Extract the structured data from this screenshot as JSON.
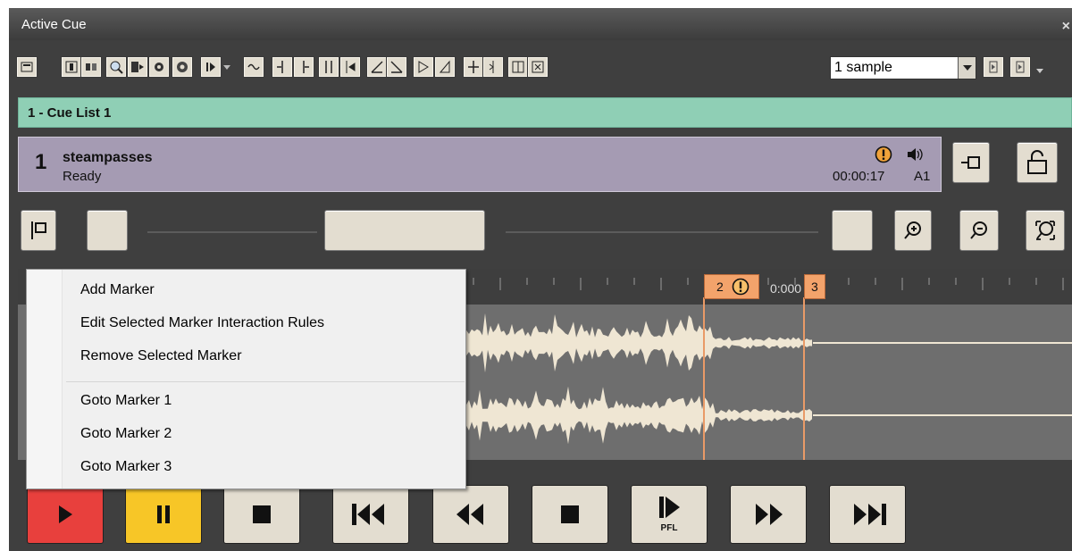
{
  "window": {
    "title": "Active Cue",
    "close_glyph": "×"
  },
  "toolbar": {
    "icons": [
      "properties-icon",
      "output-icon",
      "audio-output-icon",
      "zoom-icon",
      "audio-routing-icon",
      "settings-icon",
      "advanced-settings-icon",
      "play-options-icon",
      "loop-icon",
      "marker-left-icon",
      "marker-right-icon",
      "marker-start-icon",
      "marker-end-icon",
      "fade-in-icon",
      "fade-out-icon",
      "gain-in-icon",
      "gain-out-icon",
      "split-icon",
      "join-icon",
      "snap-left-icon",
      "snap-right-icon"
    ],
    "resolution_value": "1 sample",
    "nav_prev_icon": "nudge-left-icon",
    "nav_next_icon": "nudge-right-icon"
  },
  "cue_list": {
    "label": "1 - Cue List 1",
    "color": "#8fcfb5"
  },
  "cue": {
    "number": "1",
    "name": "steampasses",
    "status": "Ready",
    "duration": "00:00:17",
    "output": "A1",
    "panel_color": "#a59bb3"
  },
  "waveform": {
    "ruler_text": "0:000",
    "markers": [
      {
        "number": "2",
        "has_warning": true
      },
      {
        "number": "3",
        "has_warning": false
      }
    ],
    "marker_color": "#f3a36b"
  },
  "context_menu": {
    "items": [
      "Add Marker",
      "Edit Selected Marker Interaction Rules",
      "Remove Selected Marker",
      "Goto Marker 1",
      "Goto Marker 2",
      "Goto Marker 3"
    ]
  },
  "transport": {
    "play_color": "#e8403d",
    "pause_color": "#f7c627",
    "buttons": [
      "play-icon",
      "pause-icon",
      "stop-icon",
      "skip-to-start-icon",
      "rewind-icon",
      "stop-icon",
      "pfl-play-icon",
      "fast-forward-icon",
      "skip-to-end-icon"
    ],
    "pfl_label": "PFL"
  }
}
